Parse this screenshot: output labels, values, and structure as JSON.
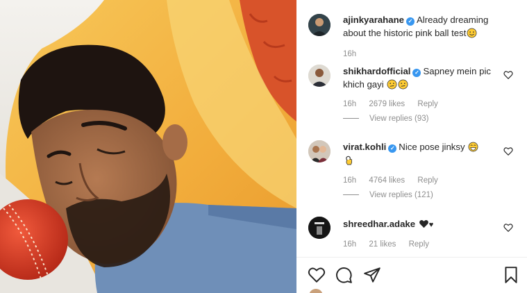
{
  "post": {
    "author": "ajinkyarahane",
    "caption": "Already dreaming about the historic pink ball test",
    "time": "16h"
  },
  "comments": [
    {
      "user": "shikhardofficial",
      "verified": true,
      "text": "Sapney mein pic khich gayi",
      "time": "16h",
      "likes": "2679 likes",
      "reply": "Reply",
      "view_replies": "View replies (93)"
    },
    {
      "user": "virat.kohli",
      "verified": true,
      "text": "Nice pose jinksy",
      "time": "16h",
      "likes": "4764 likes",
      "reply": "Reply",
      "view_replies": "View replies (121)"
    },
    {
      "user": "shreedhar.adake",
      "verified": false,
      "text": "♥",
      "time": "16h",
      "likes": "21 likes",
      "reply": "Reply"
    }
  ],
  "icons": {
    "like": "heart-icon",
    "comment": "comment-icon",
    "share": "share-icon",
    "save": "bookmark-icon",
    "verified": "verified-badge-icon"
  },
  "colors": {
    "verified": "#3897f0",
    "text": "#262626",
    "muted": "#8e8e8e"
  }
}
